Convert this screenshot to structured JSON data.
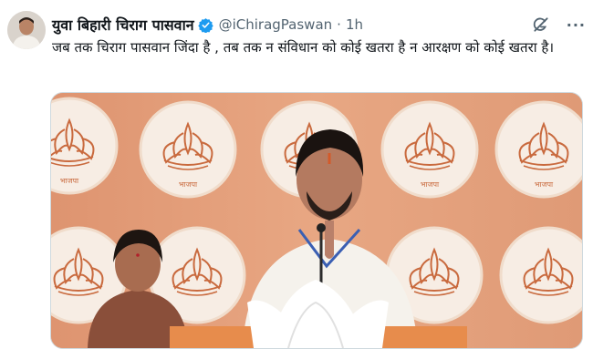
{
  "author": {
    "display_name": "युवा बिहारी चिराग पासवान",
    "handle": "@iChiragPaswan",
    "separator": "·",
    "time": "1h"
  },
  "tweet": {
    "text": "जब तक चिराग पासवान जिंदा है , तब तक न संविधान को कोई खतरा है न आरक्षण को कोई खतरा है।"
  },
  "icons": {
    "verified": "verified-badge-icon",
    "grok": "grok-icon",
    "more": "more-options-icon"
  },
  "colors": {
    "verified_blue": "#1d9bf0",
    "secondary_text": "#536471",
    "backdrop_orange": "#e29a74"
  },
  "media": {
    "lotus_caption": "भाजपा"
  }
}
